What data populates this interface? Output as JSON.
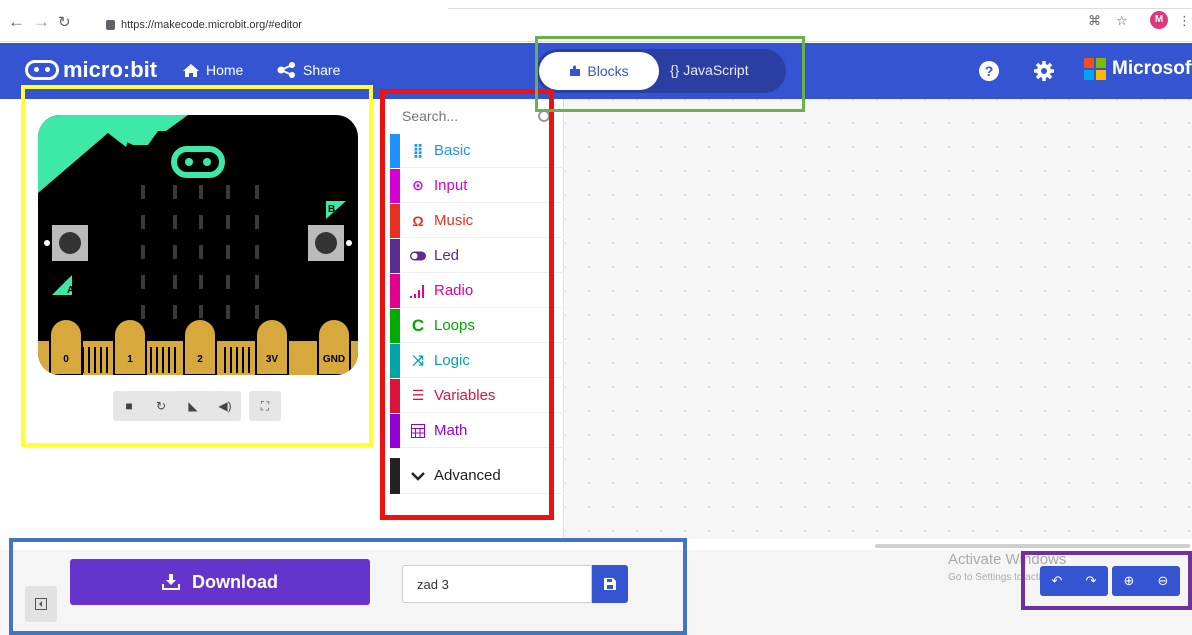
{
  "browser": {
    "url": "https://makecode.microbit.org/#editor",
    "avatar_letter": "M"
  },
  "header": {
    "logo_text": "micro:bit",
    "home_label": "Home",
    "share_label": "Share",
    "blocks_label": "Blocks",
    "javascript_label": "{} JavaScript",
    "brand_label": "Microsoft",
    "accent_color": "#3454d1"
  },
  "simulator": {
    "pins": [
      "0",
      "1",
      "2",
      "3V",
      "GND"
    ],
    "button_a": "A",
    "button_b": "B"
  },
  "toolbox": {
    "search_placeholder": "Search...",
    "categories": [
      {
        "label": "Basic",
        "color": "#1e90ff",
        "icon": "grid-icon"
      },
      {
        "label": "Input",
        "color": "#d400d4",
        "icon": "target-icon"
      },
      {
        "label": "Music",
        "color": "#e63022",
        "icon": "headphones-icon"
      },
      {
        "label": "Led",
        "color": "#5c2d91",
        "icon": "toggle-icon"
      },
      {
        "label": "Radio",
        "color": "#e3008c",
        "icon": "signal-icon"
      },
      {
        "label": "Loops",
        "color": "#00aa00",
        "icon": "loop-icon"
      },
      {
        "label": "Logic",
        "color": "#00a4a6",
        "icon": "shuffle-icon"
      },
      {
        "label": "Variables",
        "color": "#dc143c",
        "icon": "lines-icon"
      },
      {
        "label": "Math",
        "color": "#9400d3",
        "icon": "calculator-icon"
      },
      {
        "label": "Advanced",
        "color": "#222222",
        "icon": "chevron-down-icon"
      }
    ]
  },
  "bottom": {
    "download_label": "Download",
    "project_name": "zad 3"
  },
  "watermark": {
    "line1": "Activate Windows",
    "line2": "Go to Settings to activate Windows."
  }
}
